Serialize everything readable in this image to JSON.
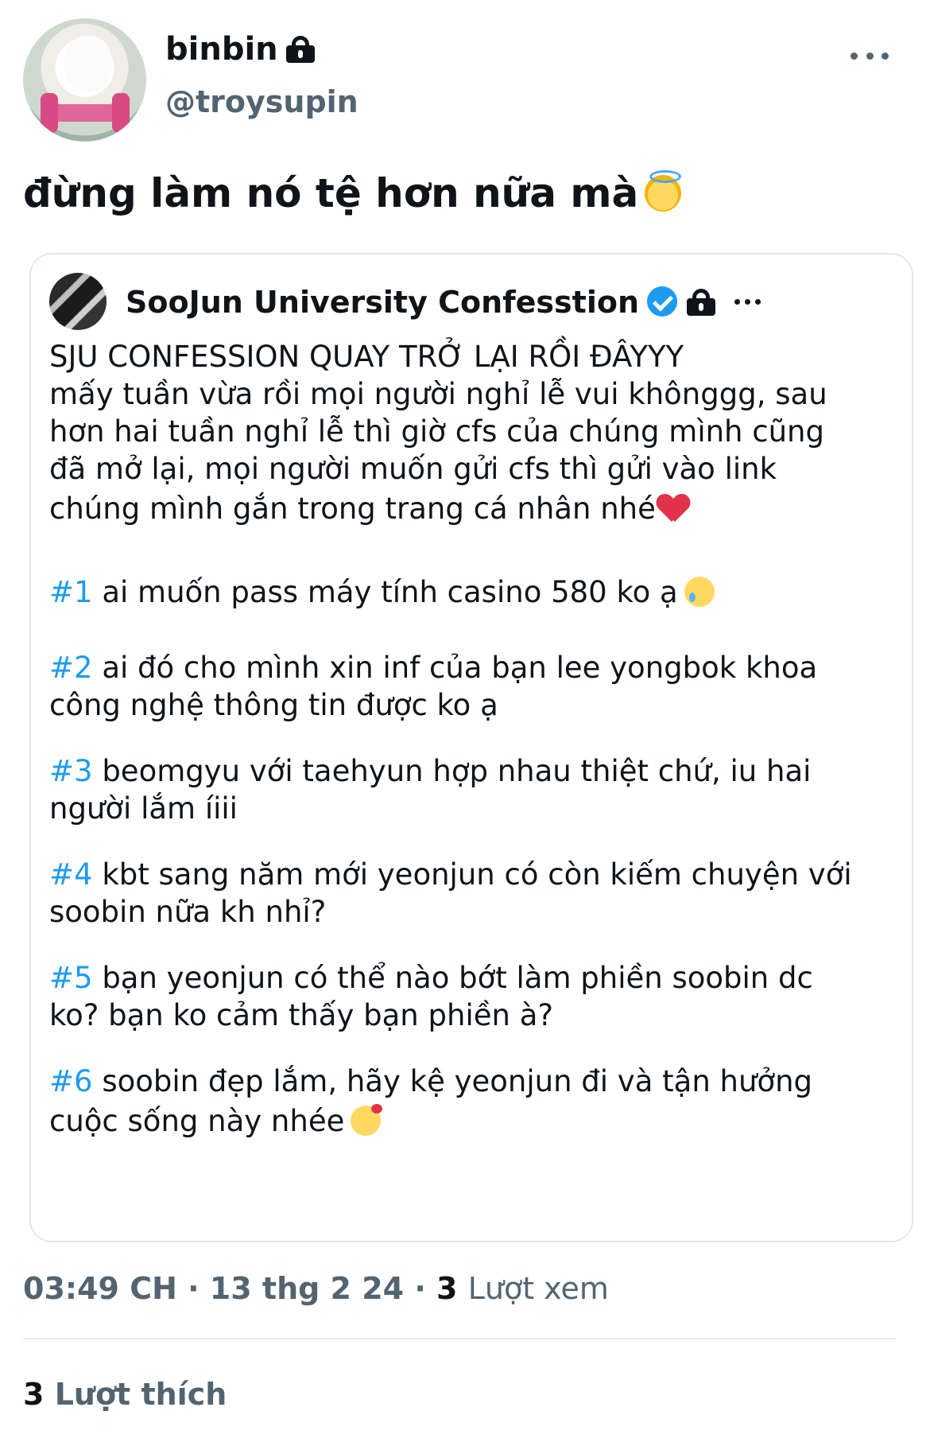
{
  "author": {
    "display_name": "binbin",
    "handle": "@troysupin",
    "avatar_icon": "snowball-rabbit-avatar",
    "lock_icon": "lock-icon"
  },
  "tweet": {
    "text": "đừng làm nó tệ hơn nữa mà",
    "emoji": "smiling-face-with-halo"
  },
  "quoted": {
    "name": "SooJun University Confesstion",
    "verified": true,
    "locked": true,
    "intro": [
      "SJU CONFESSION QUAY TRỞ LẠI RỒI ĐÂYYY",
      "mấy tuần vừa rồi mọi người nghỉ lễ vui khônggg, sau",
      "hơn hai tuần nghỉ lễ thì giờ cfs của chúng mình cũng",
      "đã mở lại, mọi người muốn gửi cfs thì gửi vào link",
      "chúng mình gắn trong trang cá nhân nhé"
    ],
    "confessions": [
      {
        "tag": "#1",
        "lines": [
          "ai muốn pass máy tính casino 580 ko ạ"
        ]
      },
      {
        "tag": "#2",
        "lines": [
          "ai đó cho mình xin inf của bạn lee yongbok khoa",
          "công nghệ thông tin được ko ạ"
        ]
      },
      {
        "tag": "#3",
        "lines": [
          "beomgyu với taehyun hợp nhau thiệt chứ, iu hai",
          "người lắm íiii"
        ]
      },
      {
        "tag": "#4",
        "lines": [
          "kbt sang năm mới yeonjun có còn kiếm chuyện với",
          "soobin nữa kh nhỉ?"
        ]
      },
      {
        "tag": "#5",
        "lines": [
          "bạn yeonjun có thể nào bớt làm phiền soobin dc",
          "ko? bạn ko cảm thấy bạn phiền à?"
        ]
      },
      {
        "tag": "#6",
        "lines": [
          "soobin đẹp lắm, hãy kệ yeonjun đi và tận hưởng",
          "cuộc sống này nhée"
        ]
      }
    ]
  },
  "meta": {
    "time": "03:49 CH",
    "date": "13 thg 2 24",
    "views_count": "3",
    "views_label": "Lượt xem"
  },
  "likes": {
    "count": "3",
    "label": "Lượt thích"
  },
  "colors": {
    "text": "#0f1419",
    "secondary": "#536471",
    "link": "#1d9bf0",
    "border": "#e1e8ed"
  }
}
